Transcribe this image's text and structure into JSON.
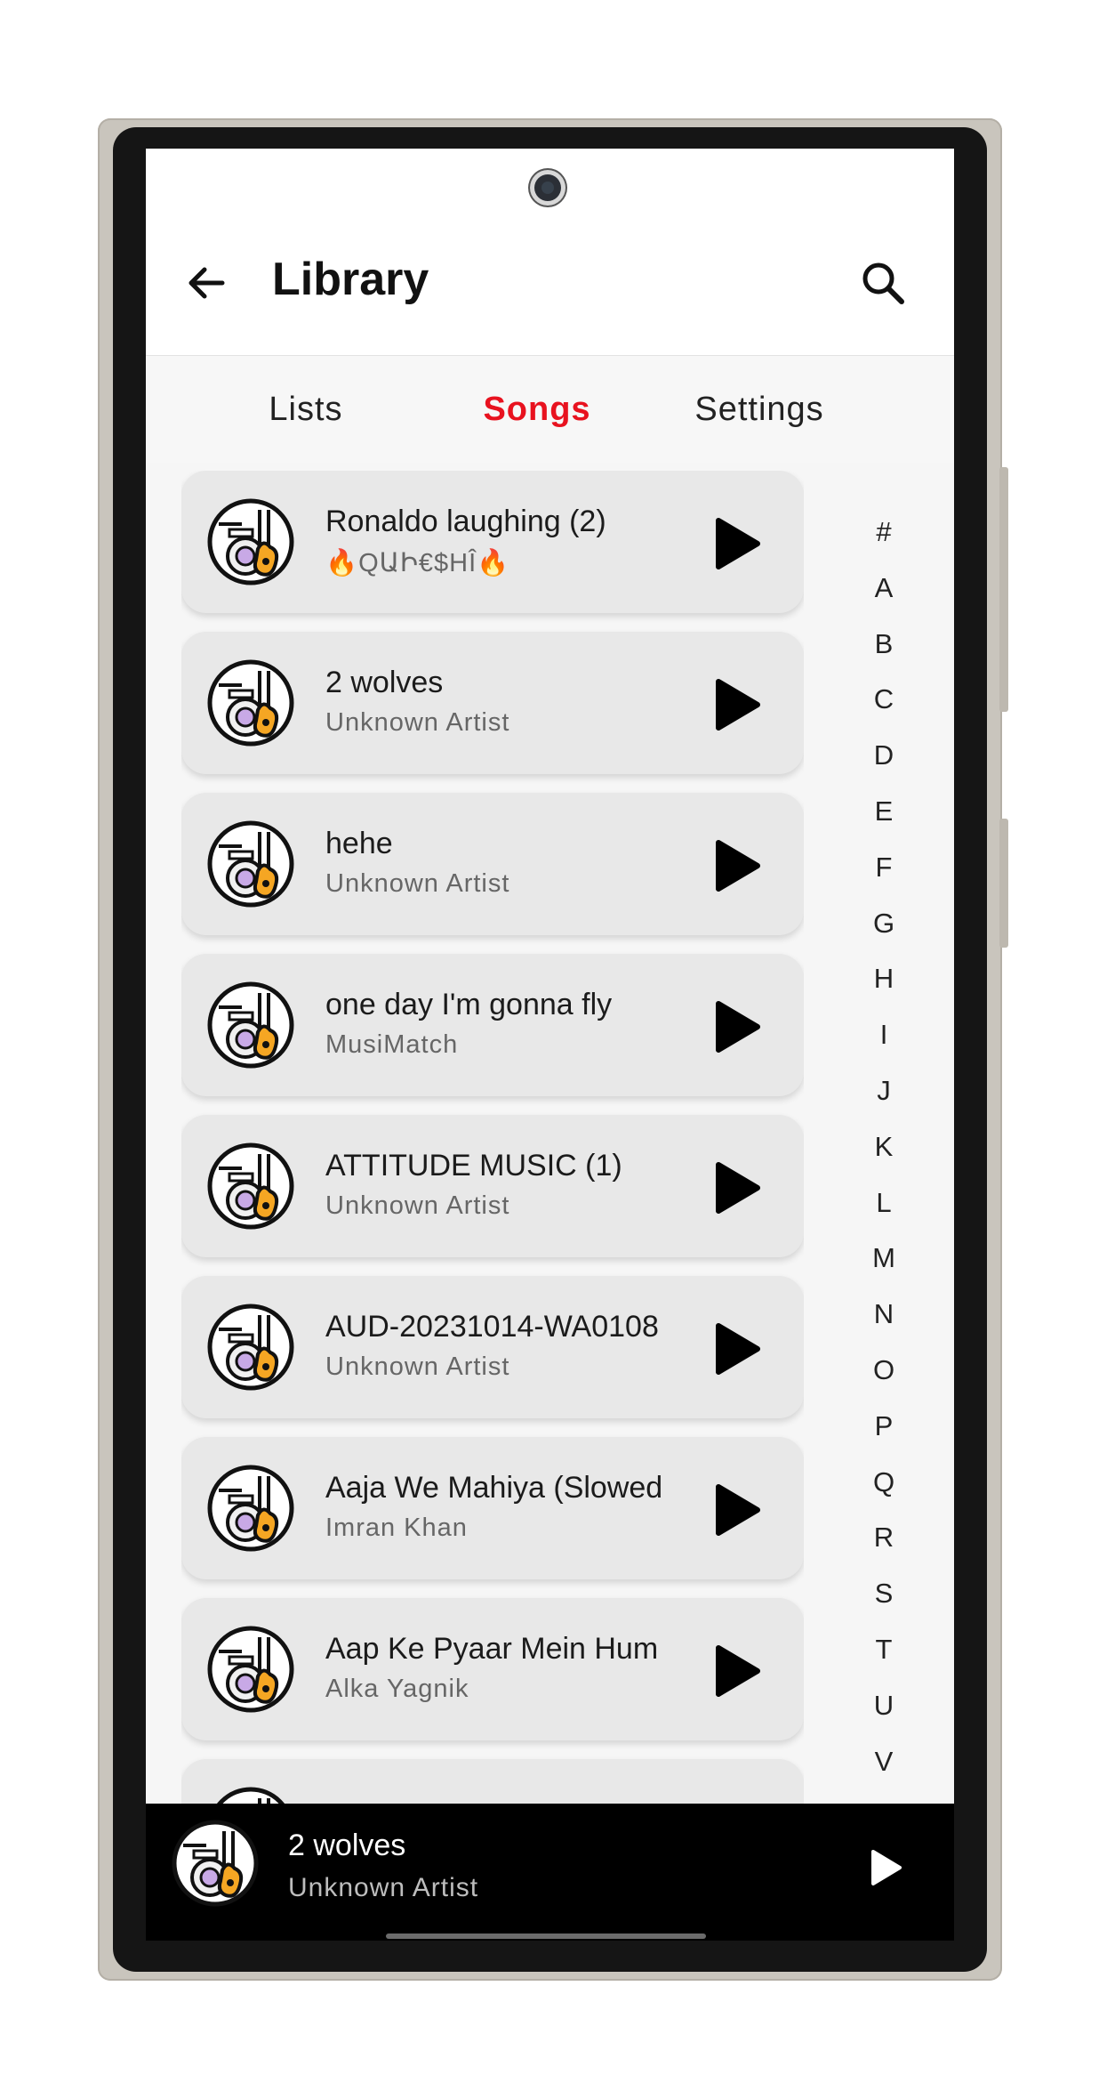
{
  "app": {
    "title": "Library"
  },
  "tabs": [
    {
      "label": "Lists",
      "active": false
    },
    {
      "label": "Songs",
      "active": true
    },
    {
      "label": "Settings",
      "active": false
    }
  ],
  "songs": [
    {
      "title": "Ronaldo laughing (2)",
      "artist": "🔥QԱԻ€$HÎ🔥"
    },
    {
      "title": "2 wolves",
      "artist": "Unknown Artist"
    },
    {
      "title": "hehe",
      "artist": "Unknown Artist"
    },
    {
      "title": "one day I'm gonna fly",
      "artist": "MusiMatch"
    },
    {
      "title": "ATTITUDE MUSIC (1)",
      "artist": "Unknown Artist"
    },
    {
      "title": "AUD-20231014-WA0108",
      "artist": "Unknown Artist"
    },
    {
      "title": "Aaja We Mahiya (Slowed",
      "artist": "Imran Khan"
    },
    {
      "title": "Aap Ke Pyaar Mein Hum",
      "artist": "Alka Yagnik"
    }
  ],
  "alphabet": [
    "#",
    "A",
    "B",
    "C",
    "D",
    "E",
    "F",
    "G",
    "H",
    "I",
    "J",
    "K",
    "L",
    "M",
    "N",
    "O",
    "P",
    "Q",
    "R",
    "S",
    "T",
    "U",
    "V"
  ],
  "now_playing": {
    "title": "2 wolves",
    "artist": "Unknown Artist"
  },
  "icons": {
    "back": "arrow-left-icon",
    "search": "search-icon",
    "play": "play-icon",
    "thumbnail": "music-instruments-icon"
  },
  "colors": {
    "accent": "#e8121f",
    "card": "#e8e8e8",
    "player": "#000000"
  }
}
